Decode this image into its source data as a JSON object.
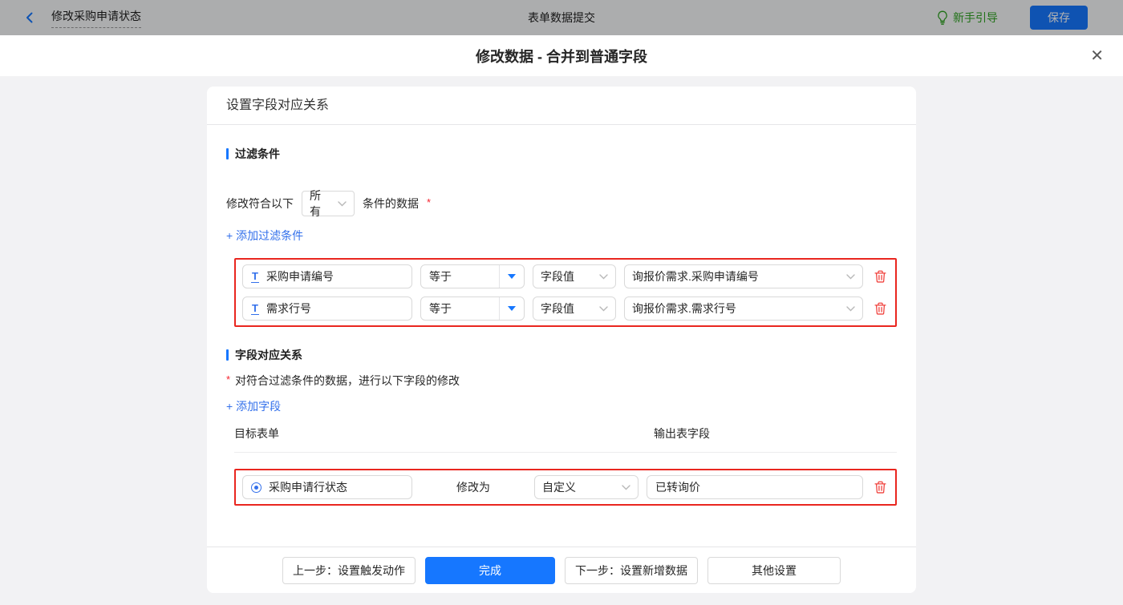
{
  "topbar": {
    "back_title": "修改采购申请状态",
    "center_title": "表单数据提交",
    "guide_label": "新手引导",
    "save_label": "保存"
  },
  "modal": {
    "title": "修改数据 - 合并到普通字段",
    "close_glyph": "✕"
  },
  "panel": {
    "header": "设置字段对应关系",
    "filter_section": {
      "title": "过滤条件",
      "match_prefix": "修改符合以下",
      "match_select_value": "所有",
      "match_suffix": "条件的数据",
      "required_mark": "*",
      "add_link": "+ 添加过滤条件",
      "rows": [
        {
          "field_icon": "T",
          "field": "采购申请编号",
          "operator": "等于",
          "value_type": "字段值",
          "value": "询报价需求.采购申请编号"
        },
        {
          "field_icon": "T",
          "field": "需求行号",
          "operator": "等于",
          "value_type": "字段值",
          "value": "询报价需求.需求行号"
        }
      ]
    },
    "mapping_section": {
      "title": "字段对应关系",
      "required_mark": "*",
      "hint": "对符合过滤条件的数据，进行以下字段的修改",
      "add_link": "+ 添加字段",
      "columns": {
        "target_form": "目标表单",
        "output_field": "输出表字段"
      },
      "rows": [
        {
          "field": "采购申请行状态",
          "action_label": "修改为",
          "mode": "自定义",
          "value": "已转询价"
        }
      ]
    },
    "footer": {
      "prev_label": "上一步：设置触发动作",
      "done_label": "完成",
      "next_label": "下一步：设置新增数据",
      "other_label": "其他设置"
    }
  },
  "colors": {
    "primary_blue": "#1677ff",
    "link_blue": "#3370eb",
    "guide_green": "#2ea321",
    "highlight_red": "#e9261f",
    "trash_red": "#f0413c",
    "page_gray": "#f2f2f4"
  }
}
